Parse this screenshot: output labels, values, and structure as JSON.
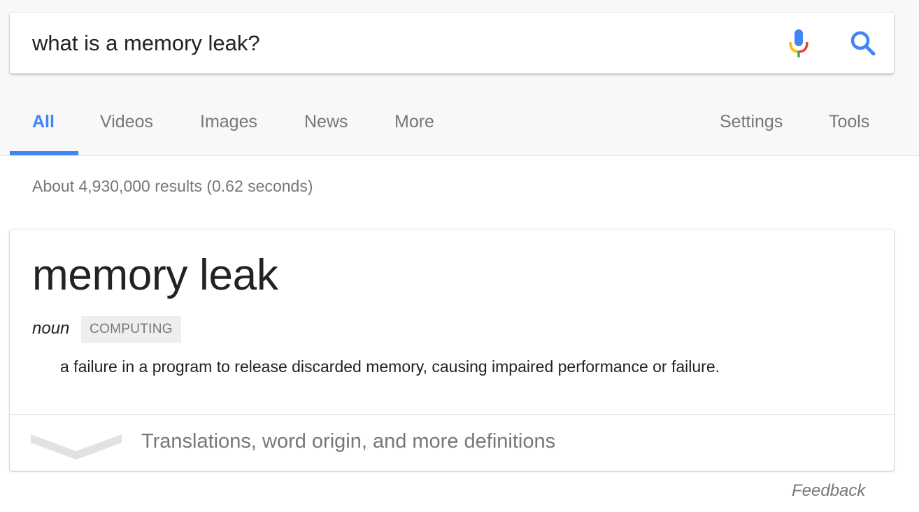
{
  "search": {
    "query": "what is a memory leak?"
  },
  "tabs": [
    {
      "label": "All",
      "active": true
    },
    {
      "label": "Videos"
    },
    {
      "label": "Images"
    },
    {
      "label": "News"
    },
    {
      "label": "More"
    }
  ],
  "tools": {
    "settings_label": "Settings",
    "tools_label": "Tools"
  },
  "result_stats": "About 4,930,000 results (0.62 seconds)",
  "definition_card": {
    "term": "memory leak",
    "part_of_speech": "noun",
    "domain_label": "COMPUTING",
    "definition": "a failure in a program to release discarded memory, causing impaired performance or failure.",
    "more_label": "Translations, word origin, and more definitions"
  },
  "feedback_label": "Feedback",
  "icons": {
    "mic": "microphone-icon",
    "search": "search-icon",
    "expand": "chevron-down-icon"
  },
  "colors": {
    "accent": "#4285f4",
    "mic_red": "#ea4335",
    "mic_yellow": "#fbbc05",
    "mic_green": "#34a853",
    "muted_text": "#777777"
  }
}
